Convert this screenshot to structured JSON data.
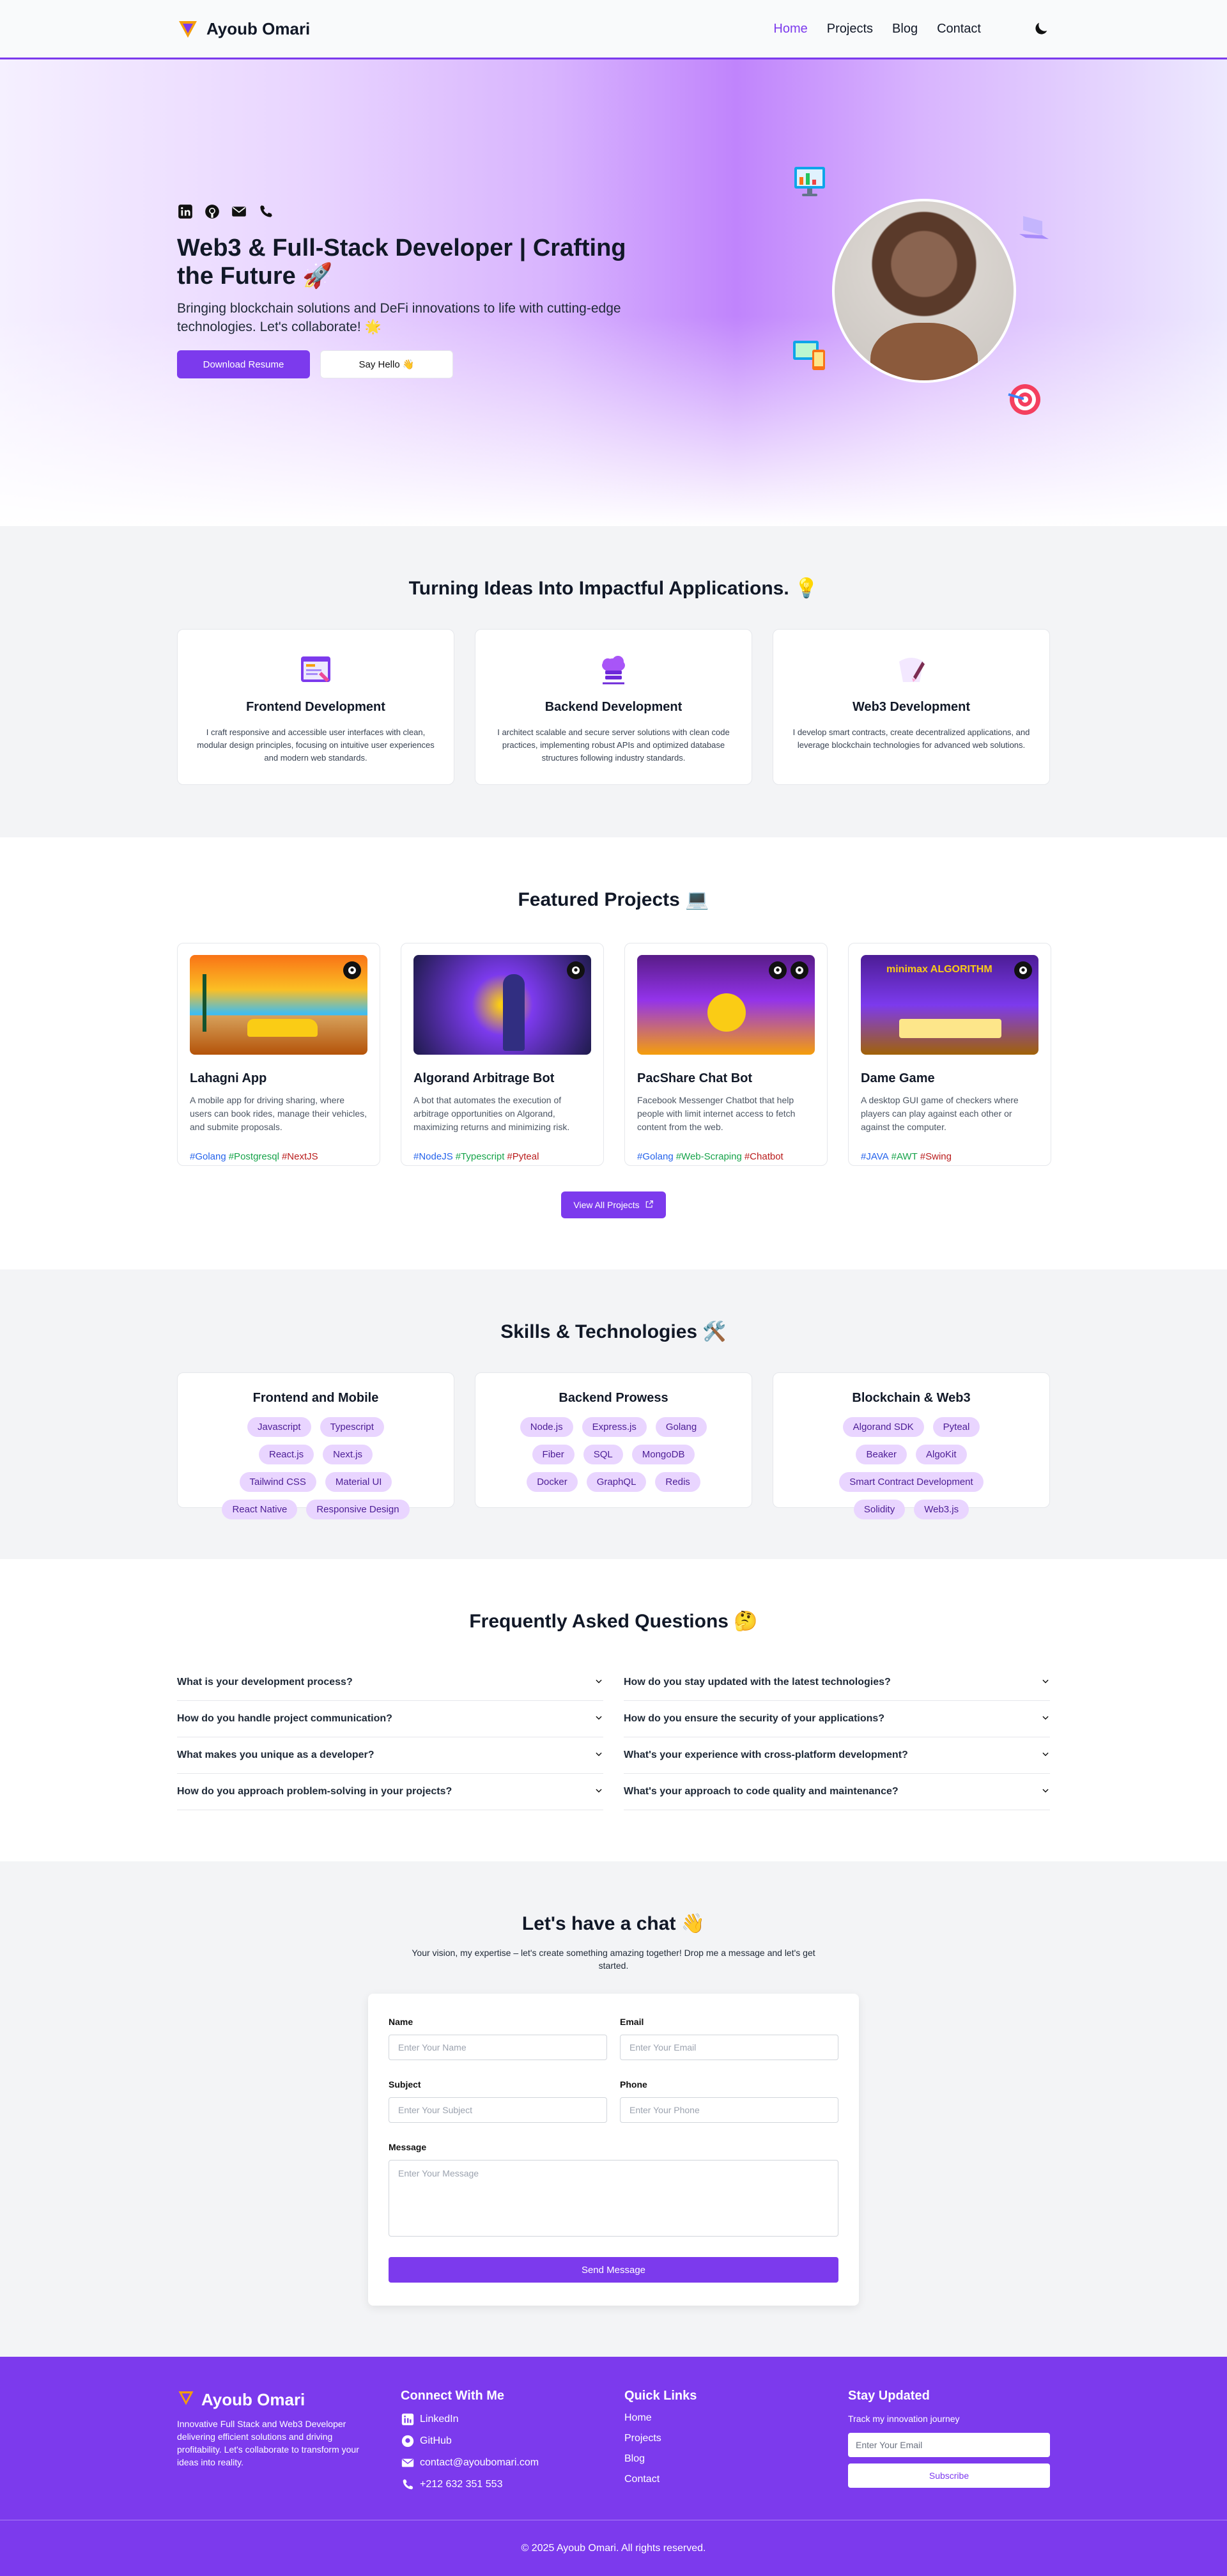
{
  "brand": {
    "name": "Ayoub Omari"
  },
  "nav": {
    "items": [
      "Home",
      "Projects",
      "Blog",
      "Contact"
    ]
  },
  "hero": {
    "title": "Web3 & Full-Stack Developer | Crafting the Future 🚀",
    "subtitle": "Bringing blockchain solutions and DeFi innovations to life with cutting-edge technologies. Let's collaborate! 🌟",
    "resume": "Download Resume",
    "hello": "Say Hello 👋",
    "socials": [
      "linkedin-icon",
      "github-icon",
      "mail-icon",
      "phone-icon"
    ]
  },
  "services": {
    "title": "Turning Ideas Into Impactful Applications. 💡",
    "items": [
      {
        "title": "Frontend Development",
        "text": "I craft responsive and accessible user interfaces with clean, modular design principles, focusing on intuitive user experiences and modern web standards."
      },
      {
        "title": "Backend Development",
        "text": "I architect scalable and secure server solutions with clean code practices, implementing robust APIs and optimized database structures following industry standards."
      },
      {
        "title": "Web3 Development",
        "text": "I develop smart contracts, create decentralized applications, and leverage blockchain technologies for advanced web solutions."
      }
    ]
  },
  "projects": {
    "title": "Featured Projects 💻",
    "items": [
      {
        "title": "Lahagni App",
        "text": "A mobile app for driving sharing, where users can book rides, manage their vehicles, and submite proposals.",
        "tags": [
          "#Golang",
          "#Postgresql",
          "#NextJS"
        ]
      },
      {
        "title": "Algorand Arbitrage Bot",
        "text": "A bot that automates the execution of arbitrage opportunities on Algorand, maximizing returns and minimizing risk.",
        "tags": [
          "#NodeJS",
          "#Typescript",
          "#Pyteal"
        ]
      },
      {
        "title": "PacShare Chat Bot",
        "text": "Facebook Messenger Chatbot that help people with limit internet access to fetch content from the web.",
        "tags": [
          "#Golang",
          "#Web-Scraping",
          "#Chatbot"
        ]
      },
      {
        "title": "Dame Game",
        "text": "A desktop GUI game of checkers where players can play against each other or against the computer.",
        "tags": [
          "#JAVA",
          "#AWT",
          "#Swing"
        ]
      }
    ],
    "thumb_text": "minimax ALGORITHM",
    "view_all": "View All Projects"
  },
  "skills": {
    "title": "Skills & Technologies 🛠️",
    "groups": [
      {
        "title": "Frontend and Mobile",
        "items": [
          "Javascript",
          "Typescript",
          "React.js",
          "Next.js",
          "Tailwind CSS",
          "Material UI",
          "React Native",
          "Responsive Design"
        ]
      },
      {
        "title": "Backend Prowess",
        "items": [
          "Node.js",
          "Express.js",
          "Golang",
          "Fiber",
          "SQL",
          "MongoDB",
          "Docker",
          "GraphQL",
          "Redis"
        ]
      },
      {
        "title": "Blockchain & Web3",
        "items": [
          "Algorand SDK",
          "Pyteal",
          "Beaker",
          "AlgoKit",
          "Smart Contract Development",
          "Solidity",
          "Web3.js"
        ]
      }
    ]
  },
  "faq": {
    "title": "Frequently Asked Questions 🤔",
    "left": [
      "What is your development process?",
      "How do you handle project communication?",
      "What makes you unique as a developer?",
      "How do you approach problem-solving in your projects?"
    ],
    "right": [
      "How do you stay updated with the latest technologies?",
      "How do you ensure the security of your applications?",
      "What's your experience with cross-platform development?",
      "What's your approach to code quality and maintenance?"
    ]
  },
  "contact": {
    "title": "Let's have a chat 👋",
    "subtitle": "Your vision, my expertise – let's create something amazing together! Drop me a message and let's get started.",
    "name_label": "Name",
    "name_ph": "Enter Your Name",
    "email_label": "Email",
    "email_ph": "Enter Your Email",
    "subject_label": "Subject",
    "subject_ph": "Enter Your Subject",
    "phone_label": "Phone",
    "phone_ph": "Enter Your Phone",
    "message_label": "Message",
    "message_ph": "Enter Your Message",
    "send": "Send Message"
  },
  "footer": {
    "brand": "Ayoub Omari",
    "about": "Innovative Full Stack and Web3 Developer delivering efficient solutions and driving profitability. Let's collaborate to transform your ideas into reality.",
    "connect_title": "Connect With Me",
    "connect": [
      "LinkedIn",
      "GitHub",
      "contact@ayoubomari.com",
      "+212 632 351 553"
    ],
    "links_title": "Quick Links",
    "links": [
      "Home",
      "Projects",
      "Blog",
      "Contact"
    ],
    "updated_title": "Stay Updated",
    "updated_text": "Track my innovation journey",
    "email_ph": "Enter Your Email",
    "subscribe": "Subscribe",
    "copyright": "© 2025 Ayoub Omari. All rights reserved."
  },
  "colors": {
    "accent": "#7c3aed",
    "tag_blue": "#2563eb",
    "tag_green": "#16a34a",
    "tag_red": "#b91c1c"
  }
}
